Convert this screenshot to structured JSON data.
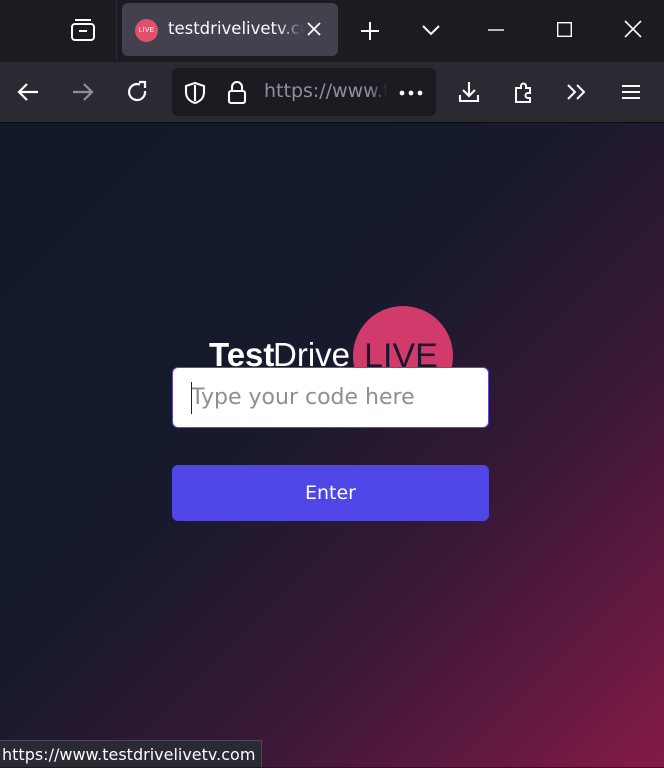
{
  "browser": {
    "tab": {
      "favicon_text": "LIVE",
      "title": "testdrivelivetv.com",
      "close_icon": "close-icon"
    },
    "toolbar_icons": {
      "tab_overview": "tab-overview-icon",
      "new_tab": "plus-icon",
      "list_all_tabs": "chevron-down-icon",
      "minimize": "minimize-icon",
      "maximize": "maximize-icon",
      "close_window": "close-icon",
      "back": "back-arrow-icon",
      "forward": "forward-arrow-icon",
      "reload": "reload-icon",
      "tracking_protection": "shield-icon",
      "site_info": "lock-icon",
      "page_actions": "more-icon",
      "downloads": "download-icon",
      "extensions": "puzzle-icon",
      "overflow": "double-chevron-icon",
      "menu": "hamburger-menu-icon"
    },
    "url": "https://www.testdrivelivetv.com",
    "status_url": "https://www.testdrivelivetv.com"
  },
  "page": {
    "logo": {
      "bold": "Test",
      "regular": "Drive",
      "badge": "LIVE"
    },
    "code_input": {
      "value": "",
      "placeholder": "Type your code here"
    },
    "enter_button": "Enter"
  },
  "colors": {
    "accent_button": "#4f46e5",
    "logo_circle": "#d13b6b",
    "background_start": "#111827",
    "background_end": "#841a46"
  }
}
